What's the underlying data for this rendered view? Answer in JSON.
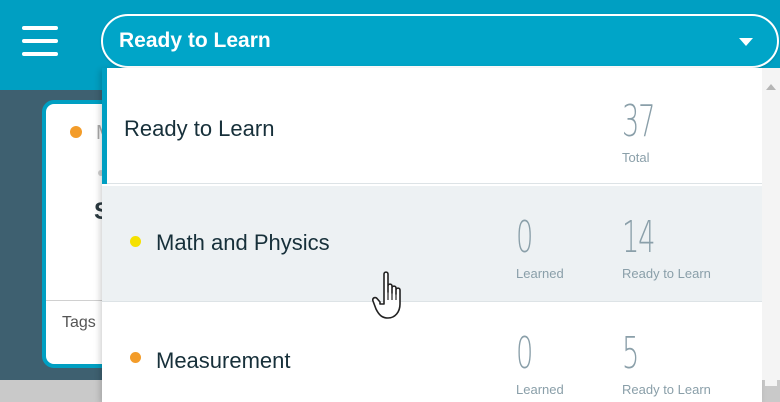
{
  "app": {
    "menu_icon": "hamburger-icon"
  },
  "background_card": {
    "letter_top": "M",
    "letter_mid": "S",
    "tags_label": "Tags"
  },
  "select": {
    "value": "Ready to Learn",
    "caret_icon": "caret-down-icon"
  },
  "options": [
    {
      "title": "Ready to Learn",
      "stats": [
        {
          "value": "37",
          "label": "Total"
        }
      ]
    },
    {
      "title": "Math and Physics",
      "dot_color": "#f5e100",
      "stats": [
        {
          "value": "0",
          "label": "Learned"
        },
        {
          "value": "14",
          "label": "Ready to Learn"
        }
      ]
    },
    {
      "title": "Measurement",
      "dot_color": "#f39c29",
      "stats": [
        {
          "value": "0",
          "label": "Learned"
        },
        {
          "value": "5",
          "label": "Ready to Learn"
        }
      ]
    }
  ],
  "colors": {
    "accent": "#009fc2",
    "background_dark": "#3e6070",
    "stat_gray": "#8a9fa9"
  },
  "cursor": "hand-pointer-icon"
}
